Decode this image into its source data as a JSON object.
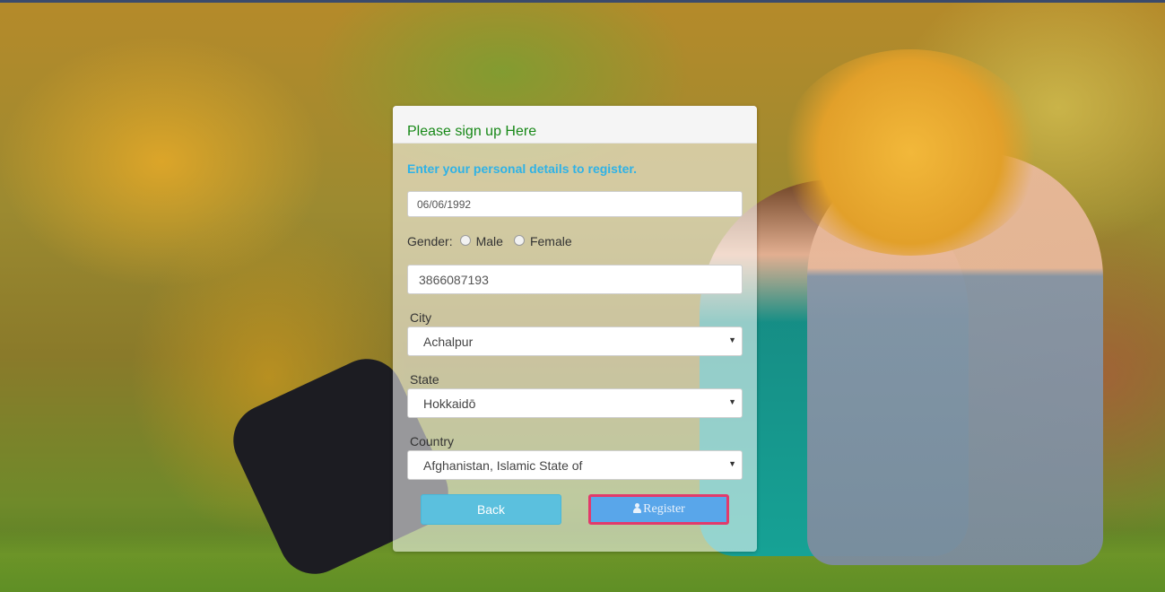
{
  "form": {
    "title": "Please sign up Here",
    "subtitle": "Enter your personal details to register.",
    "dob_value": "06/06/1992",
    "gender": {
      "label": "Gender:",
      "options": [
        "Male",
        "Female"
      ]
    },
    "phone_value": "3866087193",
    "city": {
      "label": "City",
      "selected": "Achalpur"
    },
    "state": {
      "label": "State",
      "selected": "Hokkaidō"
    },
    "country": {
      "label": "Country",
      "selected": "Afghanistan, Islamic State of"
    },
    "back_label": "Back",
    "register_label": "Register"
  },
  "icons": {
    "dropdown": "chevron-down-icon",
    "register": "user-icon"
  },
  "colors": {
    "title": "#178817",
    "subtitle": "#2fb2e6",
    "back_button": "#5bc0de",
    "register_button": "#59a6ea",
    "focus_outline": "#e23a6b"
  }
}
